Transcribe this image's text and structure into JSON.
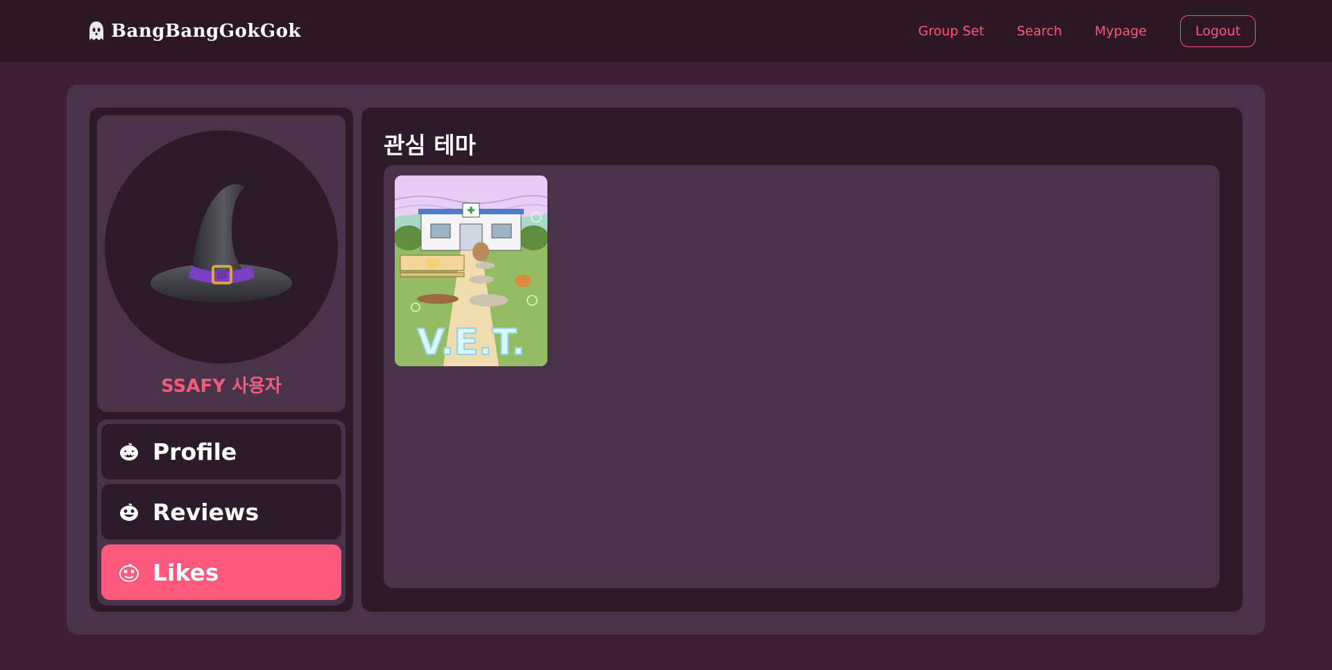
{
  "header": {
    "brand_name": "BangBangGokGok",
    "brand_icon": "ghost-icon",
    "nav": [
      "Group Set",
      "Search",
      "Mypage"
    ],
    "logout_label": "Logout",
    "accent_color": "#ff5a7e"
  },
  "profile": {
    "avatar_icon": "witch-hat-icon",
    "name": "SSAFY 사용자"
  },
  "menu": [
    {
      "label": "Profile",
      "icon": "pumpkin-icon",
      "active": false
    },
    {
      "label": "Reviews",
      "icon": "pumpkin-icon",
      "active": false
    },
    {
      "label": "Likes",
      "icon": "pumpkin-icon",
      "active": true
    }
  ],
  "main": {
    "title": "관심 테마",
    "themes": [
      {
        "title_text": "V.E.T.",
        "image": "vet-clinic-poster"
      }
    ]
  }
}
